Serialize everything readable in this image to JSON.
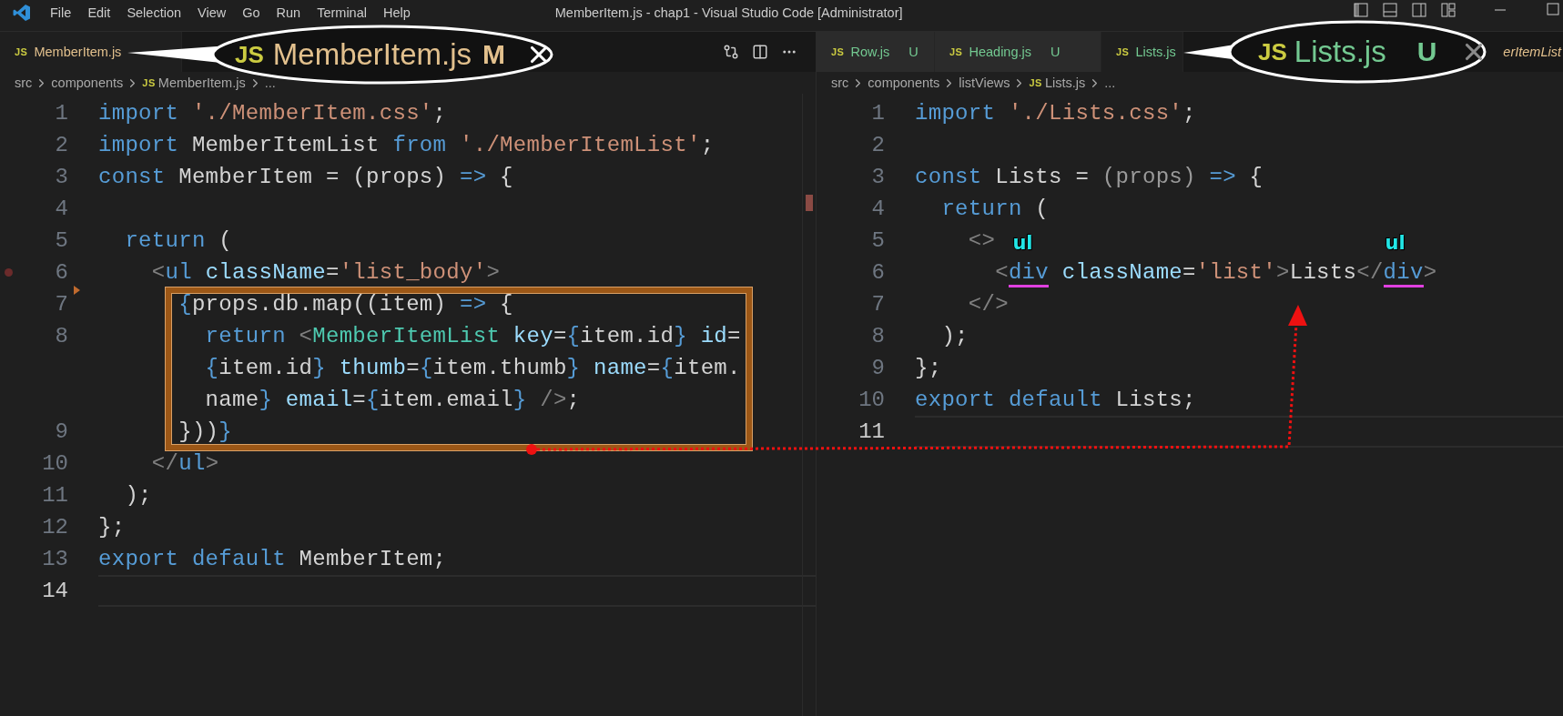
{
  "title_bar": {
    "menu": [
      "File",
      "Edit",
      "Selection",
      "View",
      "Go",
      "Run",
      "Terminal",
      "Help"
    ],
    "title": "MemberItem.js - chap1 - Visual Studio Code [Administrator]"
  },
  "editors": [
    {
      "actions_visible": true,
      "tabs": [
        {
          "icon_text": "JS",
          "label": "MemberItem.js",
          "color": "#e2c08d",
          "selected": true,
          "preview": false
        }
      ],
      "breadcrumbs": [
        {
          "label": "src"
        },
        {
          "label": "components"
        },
        {
          "label": "MemberItem.js",
          "icon_text": "JS"
        },
        {
          "label": "..."
        }
      ],
      "lines": [
        {
          "number": "1",
          "current": false,
          "rows": [
            {
              "tokens": [
                {
                  "kind": "kw",
                  "text": "import "
                },
                {
                  "kind": "str",
                  "text": "'./MemberItem.css'"
                },
                {
                  "kind": "plain",
                  "text": ";"
                }
              ]
            }
          ]
        },
        {
          "number": "2",
          "current": false,
          "rows": [
            {
              "tokens": [
                {
                  "kind": "kw",
                  "text": "import"
                },
                {
                  "kind": "plain",
                  "text": " MemberItemList "
                },
                {
                  "kind": "kw",
                  "text": "from "
                },
                {
                  "kind": "str",
                  "text": "'./MemberItemList'"
                },
                {
                  "kind": "plain",
                  "text": ";"
                }
              ]
            }
          ]
        },
        {
          "number": "3",
          "current": false,
          "rows": [
            {
              "tokens": [
                {
                  "kind": "kw",
                  "text": "const"
                },
                {
                  "kind": "plain",
                  "text": " MemberItem = (props) "
                },
                {
                  "kind": "kw",
                  "text": "=>"
                },
                {
                  "kind": "plain",
                  "text": " {"
                }
              ]
            }
          ]
        },
        {
          "number": "4",
          "current": false
        },
        {
          "number": "5",
          "current": false,
          "rows": [
            {
              "tokens": [
                {
                  "kind": "kw",
                  "text": "  return"
                },
                {
                  "kind": "plain",
                  "text": " ("
                }
              ]
            }
          ]
        },
        {
          "number": "6",
          "current": false,
          "breakpoint": true,
          "rows": [
            {
              "tokens": [
                {
                  "kind": "punct",
                  "text": "    <"
                },
                {
                  "kind": "tag",
                  "text": "ul "
                },
                {
                  "kind": "attr",
                  "text": "className"
                },
                {
                  "kind": "plain",
                  "text": "="
                },
                {
                  "kind": "str",
                  "text": "'list_body'"
                },
                {
                  "kind": "punct",
                  "text": ">"
                }
              ]
            }
          ]
        },
        {
          "number": "7",
          "current": false,
          "fold_marker": true,
          "rows": [
            {
              "tokens": [
                {
                  "kind": "brace",
                  "text": "      {"
                },
                {
                  "kind": "plain",
                  "text": "props.db.map((item) "
                },
                {
                  "kind": "kw",
                  "text": "=>"
                },
                {
                  "kind": "plain",
                  "text": " {"
                }
              ]
            }
          ]
        },
        {
          "number": "8",
          "current": false,
          "rows": [
            {
              "tokens": [
                {
                  "kind": "kw",
                  "text": "        return "
                },
                {
                  "kind": "punct",
                  "text": "<"
                },
                {
                  "kind": "comp",
                  "text": "MemberItemList "
                },
                {
                  "kind": "attr",
                  "text": "key"
                },
                {
                  "kind": "plain",
                  "text": "="
                },
                {
                  "kind": "brace",
                  "text": "{"
                },
                {
                  "kind": "plain",
                  "text": "item.id"
                },
                {
                  "kind": "brace",
                  "text": "} "
                },
                {
                  "kind": "attr",
                  "text": "id"
                },
                {
                  "kind": "plain",
                  "text": "="
                }
              ]
            },
            {
              "tokens": [
                {
                  "kind": "brace",
                  "text": "        {"
                },
                {
                  "kind": "plain",
                  "text": "item.id"
                },
                {
                  "kind": "brace",
                  "text": "} "
                },
                {
                  "kind": "attr",
                  "text": "thumb"
                },
                {
                  "kind": "plain",
                  "text": "="
                },
                {
                  "kind": "brace",
                  "text": "{"
                },
                {
                  "kind": "plain",
                  "text": "item.thumb"
                },
                {
                  "kind": "brace",
                  "text": "} "
                },
                {
                  "kind": "attr",
                  "text": "name"
                },
                {
                  "kind": "plain",
                  "text": "="
                },
                {
                  "kind": "brace",
                  "text": "{"
                },
                {
                  "kind": "plain",
                  "text": "item."
                }
              ]
            },
            {
              "tokens": [
                {
                  "kind": "plain",
                  "text": "        name"
                },
                {
                  "kind": "brace",
                  "text": "} "
                },
                {
                  "kind": "attr",
                  "text": "email"
                },
                {
                  "kind": "plain",
                  "text": "="
                },
                {
                  "kind": "brace",
                  "text": "{"
                },
                {
                  "kind": "plain",
                  "text": "item.email"
                },
                {
                  "kind": "brace",
                  "text": "} "
                },
                {
                  "kind": "punct",
                  "text": "/>"
                },
                {
                  "kind": "plain",
                  "text": ";"
                }
              ]
            }
          ]
        },
        {
          "number": "9",
          "current": false,
          "rows": [
            {
              "tokens": [
                {
                  "kind": "plain",
                  "text": "      }))"
                },
                {
                  "kind": "brace",
                  "text": "}"
                }
              ]
            }
          ]
        },
        {
          "number": "10",
          "current": false,
          "rows": [
            {
              "tokens": [
                {
                  "kind": "punct",
                  "text": "    </"
                },
                {
                  "kind": "tag",
                  "text": "ul"
                },
                {
                  "kind": "punct",
                  "text": ">"
                }
              ]
            }
          ]
        },
        {
          "number": "11",
          "current": false,
          "rows": [
            {
              "tokens": [
                {
                  "kind": "plain",
                  "text": "  );"
                }
              ]
            }
          ]
        },
        {
          "number": "12",
          "current": false,
          "rows": [
            {
              "tokens": [
                {
                  "kind": "plain",
                  "text": "};"
                }
              ]
            }
          ]
        },
        {
          "number": "13",
          "current": false,
          "rows": [
            {
              "tokens": [
                {
                  "kind": "kw",
                  "text": "export default"
                },
                {
                  "kind": "plain",
                  "text": " MemberItem;"
                }
              ]
            }
          ]
        },
        {
          "number": "14",
          "current": true
        }
      ]
    },
    {
      "tabs": [
        {
          "icon_text": "JS",
          "label": "Row.js",
          "badge": "U",
          "color": "#73c991",
          "selected": false,
          "preview": false
        },
        {
          "icon_text": "JS",
          "label": "Heading.js",
          "badge": "U",
          "color": "#73c991",
          "selected": false,
          "preview": false
        },
        {
          "icon_text": "JS",
          "label": "Lists.js",
          "color": "#73c991",
          "selected": true,
          "preview": false
        },
        {
          "label": "erItemList",
          "color": "#e2c08d",
          "selected": false,
          "preview": true
        }
      ],
      "breadcrumbs": [
        {
          "label": "src"
        },
        {
          "label": "components"
        },
        {
          "label": "listViews"
        },
        {
          "label": "Lists.js",
          "icon_text": "JS"
        },
        {
          "label": "..."
        }
      ],
      "lines": [
        {
          "number": "1",
          "current": false,
          "rows": [
            {
              "tokens": [
                {
                  "kind": "kw",
                  "text": "import "
                },
                {
                  "kind": "str",
                  "text": "'./Lists.css'"
                },
                {
                  "kind": "plain",
                  "text": ";"
                }
              ]
            }
          ]
        },
        {
          "number": "2",
          "current": false
        },
        {
          "number": "3",
          "current": false,
          "rows": [
            {
              "tokens": [
                {
                  "kind": "kw",
                  "text": "const"
                },
                {
                  "kind": "plain",
                  "text": " Lists = "
                },
                {
                  "kind": "dim",
                  "text": "(props) "
                },
                {
                  "kind": "kw",
                  "text": "=>"
                },
                {
                  "kind": "plain",
                  "text": " {"
                }
              ]
            }
          ]
        },
        {
          "number": "4",
          "current": false,
          "rows": [
            {
              "tokens": [
                {
                  "kind": "kw",
                  "text": "  return"
                },
                {
                  "kind": "plain",
                  "text": " ("
                }
              ]
            }
          ]
        },
        {
          "number": "5",
          "current": false,
          "rows": [
            {
              "tokens": [
                {
                  "kind": "punct",
                  "text": "    <>"
                }
              ]
            }
          ]
        },
        {
          "number": "6",
          "current": false,
          "rows": [
            {
              "tokens": [
                {
                  "kind": "punct",
                  "text": "      <"
                },
                {
                  "kind": "tag",
                  "text": "div",
                  "underline": true,
                  "label": "ul"
                },
                {
                  "kind": "attr",
                  "text": " className"
                },
                {
                  "kind": "plain",
                  "text": "="
                },
                {
                  "kind": "str",
                  "text": "'list'"
                },
                {
                  "kind": "punct",
                  "text": ">"
                },
                {
                  "kind": "plain",
                  "text": "Lists"
                },
                {
                  "kind": "punct",
                  "text": "</"
                },
                {
                  "kind": "tag",
                  "text": "div",
                  "underline": true,
                  "label": "ul"
                },
                {
                  "kind": "punct",
                  "text": ">"
                }
              ]
            }
          ]
        },
        {
          "number": "7",
          "current": false,
          "rows": [
            {
              "tokens": [
                {
                  "kind": "punct",
                  "text": "    </>"
                }
              ]
            }
          ]
        },
        {
          "number": "8",
          "current": false,
          "rows": [
            {
              "tokens": [
                {
                  "kind": "plain",
                  "text": "  );"
                }
              ]
            }
          ]
        },
        {
          "number": "9",
          "current": false,
          "rows": [
            {
              "tokens": [
                {
                  "kind": "plain",
                  "text": "};"
                }
              ]
            }
          ]
        },
        {
          "number": "10",
          "current": false,
          "rows": [
            {
              "tokens": [
                {
                  "kind": "kw",
                  "text": "export default"
                },
                {
                  "kind": "plain",
                  "text": " Lists;"
                }
              ]
            }
          ]
        },
        {
          "number": "11",
          "current": true
        }
      ]
    }
  ],
  "callouts": [
    {
      "icon_text": "JS",
      "label": "MemberItem.js",
      "badge": "M",
      "color": "#e2c08d",
      "focused": true
    },
    {
      "icon_text": "JS",
      "label": "Lists.js",
      "badge": "U",
      "color": "#73c991",
      "focused": false
    }
  ]
}
